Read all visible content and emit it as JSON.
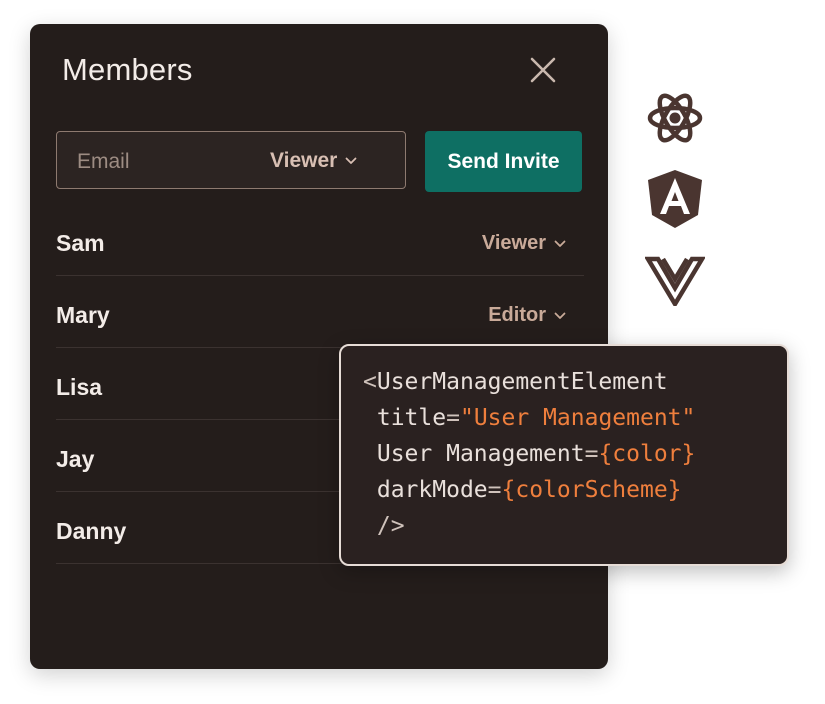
{
  "panel": {
    "title": "Members",
    "close_icon": "close-icon"
  },
  "invite": {
    "email_placeholder": "Email",
    "email_value": "",
    "role_label": "Viewer",
    "send_label": "Send Invite"
  },
  "members": [
    {
      "name": "Sam",
      "role": "Viewer"
    },
    {
      "name": "Mary",
      "role": "Editor"
    },
    {
      "name": "Lisa",
      "role": ""
    },
    {
      "name": "Jay",
      "role": ""
    },
    {
      "name": "Danny",
      "role": ""
    }
  ],
  "frameworks": [
    {
      "icon": "react-icon"
    },
    {
      "icon": "angular-icon"
    },
    {
      "icon": "vue-icon"
    }
  ],
  "code": {
    "lt": "<",
    "tag": "UserManagementElement",
    "attr1_name": "title",
    "attr1_value": "\"User Management\"",
    "attr2_name": "User Management",
    "attr2_value": "{color}",
    "attr3_name": "darkMode",
    "attr3_value": "{colorScheme}",
    "close": "/>",
    "eq": "="
  },
  "colors": {
    "panel_bg": "#241d1b",
    "accent_button": "#0e6f63",
    "code_string": "#ef7f3d",
    "icon_color": "#4a3530"
  }
}
